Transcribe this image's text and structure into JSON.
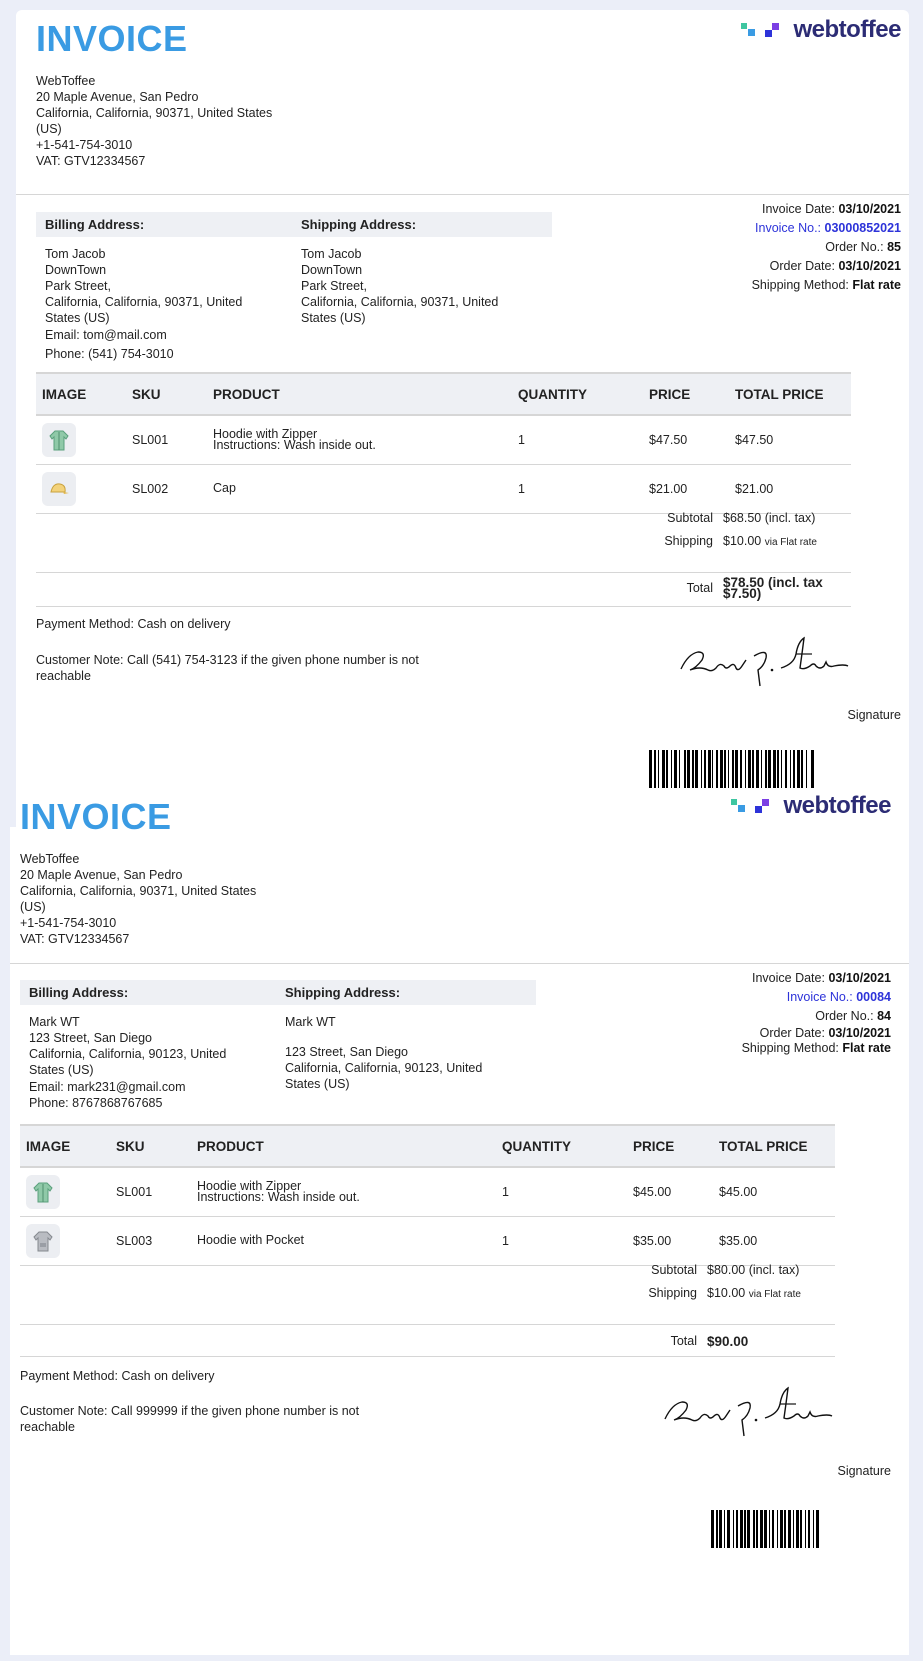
{
  "invoices": [
    {
      "title": "INVOICE",
      "logo": "webtoffee",
      "from": [
        "WebToffee",
        "20 Maple Avenue, San Pedro",
        "California, California, 90371, United States",
        "(US)",
        "+1-541-754-3010",
        "VAT: GTV12334567"
      ],
      "billing_head": "Billing Address:",
      "billing": [
        "Tom Jacob",
        "DownTown",
        "Park Street,",
        "California, California, 90371, United",
        "States (US)"
      ],
      "billing_email": "Email: tom@mail.com",
      "billing_phone": "Phone: (541) 754-3010",
      "shipping_head": "Shipping Address:",
      "shipping": [
        "Tom Jacob",
        "DownTown",
        "Park Street,",
        "California, California, 90371, United",
        "States (US)"
      ],
      "meta": {
        "invoice_date_label": "Invoice Date:",
        "invoice_date": "03/10/2021",
        "invoice_no_label": "Invoice No.:",
        "invoice_no": "03000852021",
        "order_no_label": "Order No.:",
        "order_no": "85",
        "order_date_label": "Order Date:",
        "order_date": "03/10/2021",
        "shipping_method_label": "Shipping Method:",
        "shipping_method": "Flat rate"
      },
      "headers": [
        "IMAGE",
        "SKU",
        "PRODUCT",
        "QUANTITY",
        "PRICE",
        "TOTAL PRICE"
      ],
      "rows": [
        {
          "icon": "hoodie-zipper-icon",
          "sku": "SL001",
          "product": "Hoodie with Zipper",
          "instructions": "Instructions: Wash inside out.",
          "qty": "1",
          "price": "$47.50",
          "total": "$47.50"
        },
        {
          "icon": "cap-icon",
          "sku": "SL002",
          "product": "Cap",
          "instructions": "",
          "qty": "1",
          "price": "$21.00",
          "total": "$21.00"
        }
      ],
      "subtotal_label": "Subtotal",
      "subtotal": "$68.50 (incl. tax)",
      "shipping_label": "Shipping",
      "shipping_value": "$10.00",
      "shipping_via": "via Flat rate",
      "total_label": "Total",
      "total": "$78.50 (incl. tax",
      "total_tax": "$7.50)",
      "payment": "Payment Method: Cash on delivery",
      "note": "Customer Note: Call (541) 754-3123 if the given phone number is not reachable",
      "signature_label": "Signature"
    },
    {
      "title": "INVOICE",
      "logo": "webtoffee",
      "from": [
        "WebToffee",
        "20 Maple Avenue, San Pedro",
        "California, California, 90371, United States",
        "(US)",
        "+1-541-754-3010",
        "VAT: GTV12334567"
      ],
      "billing_head": "Billing Address:",
      "billing": [
        "Mark WT",
        "123 Street, San Diego",
        "California, California, 90123, United",
        "States (US)"
      ],
      "billing_email": "Email: mark231@gmail.com",
      "billing_phone": "Phone: 8767868767685",
      "shipping_head": "Shipping Address:",
      "shipping": [
        "Mark WT",
        "",
        "123 Street, San Diego",
        "California, California, 90123, United",
        "States (US)"
      ],
      "meta": {
        "invoice_date_label": "Invoice Date:",
        "invoice_date": "03/10/2021",
        "invoice_no_label": "Invoice No.:",
        "invoice_no": "00084",
        "order_no_label": "Order No.:",
        "order_no": "84",
        "order_date_label": "Order Date:",
        "order_date": "03/10/2021",
        "shipping_method_label": "Shipping Method:",
        "shipping_method": "Flat rate"
      },
      "headers": [
        "IMAGE",
        "SKU",
        "PRODUCT",
        "QUANTITY",
        "PRICE",
        "TOTAL PRICE"
      ],
      "rows": [
        {
          "icon": "hoodie-zipper-icon",
          "sku": "SL001",
          "product": "Hoodie with Zipper",
          "instructions": "Instructions: Wash inside out.",
          "qty": "1",
          "price": "$45.00",
          "total": "$45.00"
        },
        {
          "icon": "hoodie-pocket-icon",
          "sku": "SL003",
          "product": "Hoodie with Pocket",
          "instructions": "",
          "qty": "1",
          "price": "$35.00",
          "total": "$35.00"
        }
      ],
      "subtotal_label": "Subtotal",
      "subtotal": "$80.00 (incl. tax)",
      "shipping_label": "Shipping",
      "shipping_value": "$10.00",
      "shipping_via": "via Flat rate",
      "total_label": "Total",
      "total": "$90.00",
      "total_tax": "",
      "payment": "Payment Method: Cash on delivery",
      "note": "Customer Note: Call 999999 if the given phone number is not reachable",
      "signature_label": "Signature"
    }
  ]
}
